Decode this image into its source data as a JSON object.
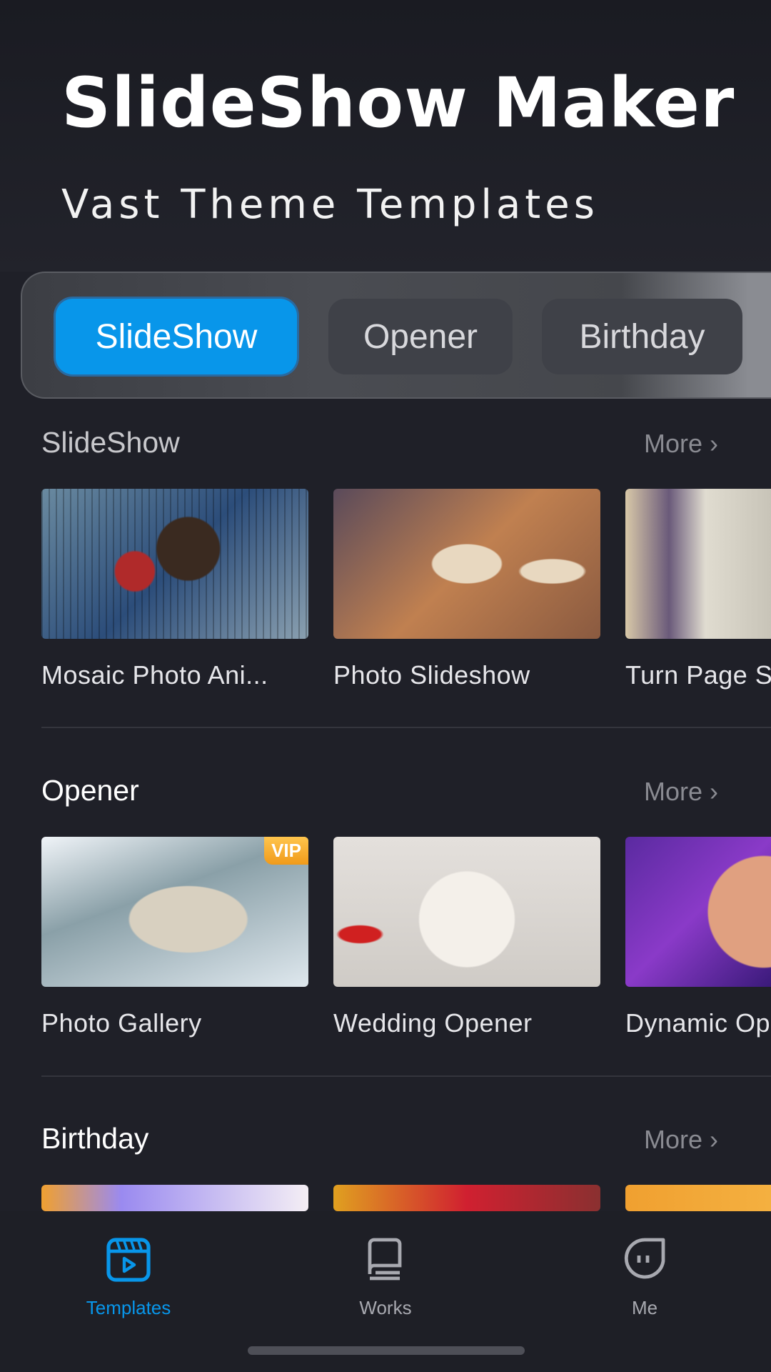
{
  "header": {
    "title": "SlideShow Maker",
    "subtitle": "Vast Theme Templates"
  },
  "category_tabs": [
    {
      "label": "SlideShow",
      "active": true
    },
    {
      "label": "Opener",
      "active": false
    },
    {
      "label": "Birthday",
      "active": false
    }
  ],
  "sections": [
    {
      "title": "SlideShow",
      "more": "More",
      "items": [
        {
          "label": "Mosaic Photo Ani..."
        },
        {
          "label": "Photo Slideshow"
        },
        {
          "label": "Turn Page S"
        }
      ]
    },
    {
      "title": "Opener",
      "more": "More",
      "items": [
        {
          "label": "Photo Gallery",
          "badge": "VIP"
        },
        {
          "label": "Wedding Opener"
        },
        {
          "label": "Dynamic Op"
        }
      ]
    },
    {
      "title": "Birthday",
      "more": "More",
      "items": [
        {
          "label": ""
        },
        {
          "label": ""
        },
        {
          "label": ""
        }
      ]
    }
  ],
  "bottom_nav": [
    {
      "label": "Templates",
      "icon": "clapper-video-icon",
      "active": true
    },
    {
      "label": "Works",
      "icon": "book-icon",
      "active": false
    },
    {
      "label": "Me",
      "icon": "face-icon",
      "active": false
    }
  ],
  "colors": {
    "accent": "#0896ea",
    "background": "#1f2028"
  }
}
